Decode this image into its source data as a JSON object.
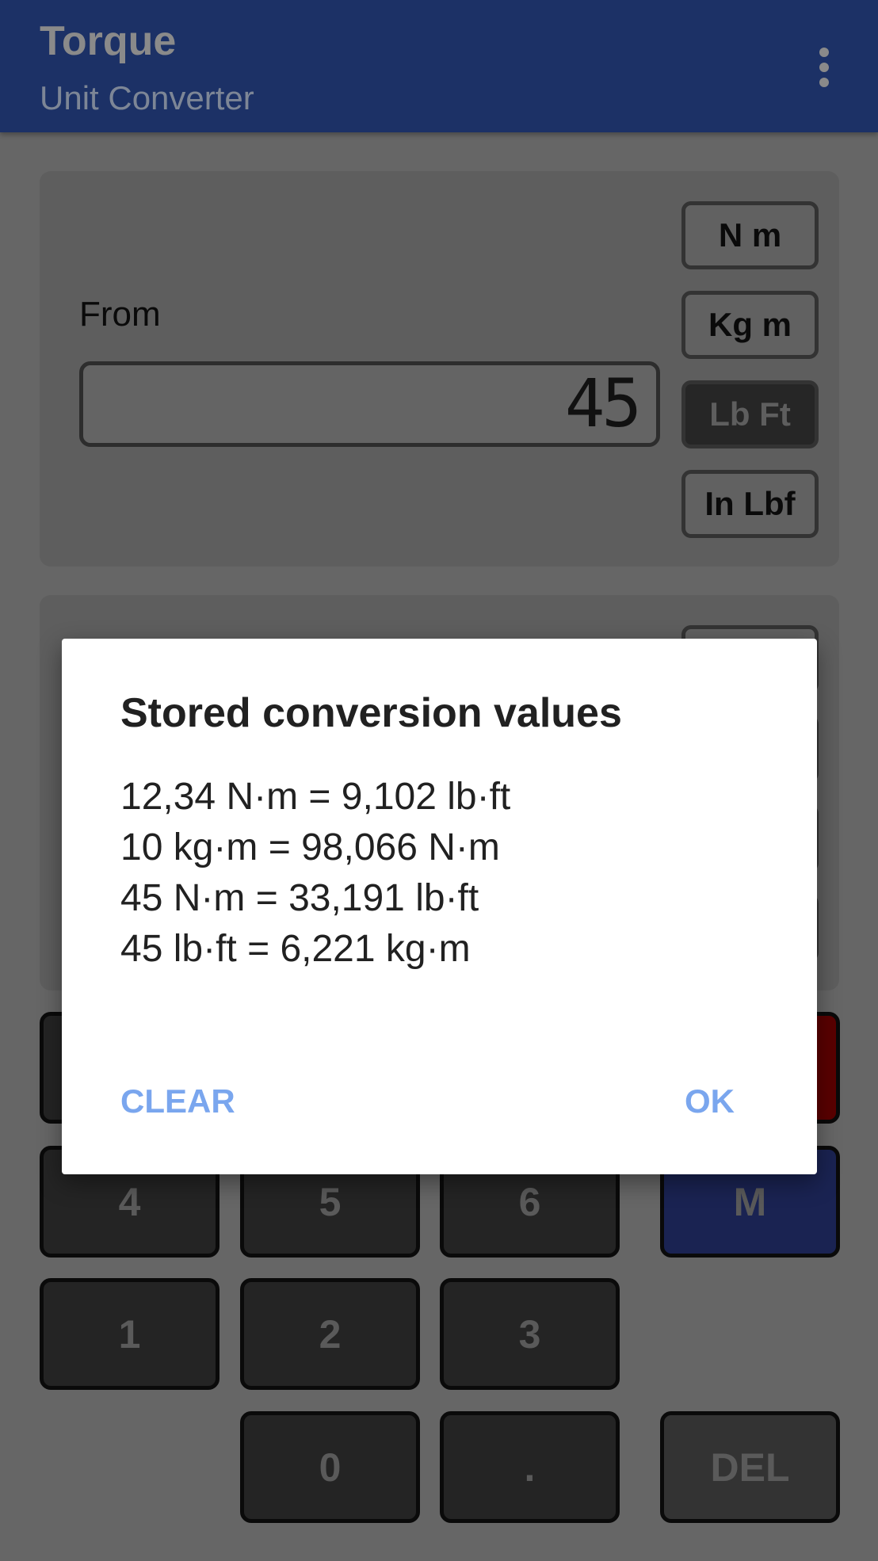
{
  "header": {
    "title": "Torque",
    "subtitle": "Unit Converter",
    "menu_icon": "more-vert-icon"
  },
  "from": {
    "label": "From",
    "value": "45",
    "units": [
      {
        "label": "N m",
        "selected": false
      },
      {
        "label": "Kg m",
        "selected": false
      },
      {
        "label": "Lb Ft",
        "selected": true
      },
      {
        "label": "In Lbf",
        "selected": false
      }
    ]
  },
  "keypad": {
    "keys": [
      "4",
      "5",
      "6",
      "M",
      "1",
      "2",
      "3",
      "0",
      ".",
      "DEL"
    ],
    "colors": {
      "key": "#242424",
      "memory": "#1a2352",
      "clear": "#5a0000",
      "delete": "#333333"
    }
  },
  "dialog": {
    "title": "Stored conversion values",
    "lines": [
      "12,34 N·m = 9,102 lb·ft",
      "10 kg·m = 98,066 N·m",
      "45 N·m = 33,191 lb·ft",
      "45 lb·ft = 6,221 kg·m"
    ],
    "clear_label": "CLEAR",
    "ok_label": "OK",
    "accent": "#7aa6ee"
  }
}
